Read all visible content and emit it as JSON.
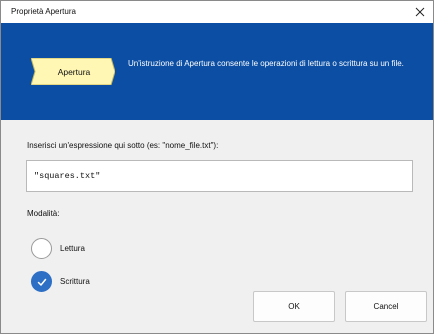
{
  "window": {
    "title": "Proprietà Apertura",
    "close_icon": "close-icon"
  },
  "banner": {
    "background_color": "#0b4ea3",
    "shape_label": "Apertura",
    "shape_color": "#fff7b3",
    "description": "Un'istruzione di Apertura consente le operazioni di lettura o scrittura su un file."
  },
  "expression": {
    "label": "Inserisci un'espressione qui sotto (es: \"nome_file.txt\"):",
    "value": "\"squares.txt\""
  },
  "mode": {
    "label": "Modalità:",
    "options": [
      {
        "label": "Lettura",
        "selected": false
      },
      {
        "label": "Scrittura",
        "selected": true
      }
    ],
    "selected_color": "#2d6fc5"
  },
  "buttons": {
    "ok_label": "OK",
    "cancel_label": "Cancel"
  }
}
